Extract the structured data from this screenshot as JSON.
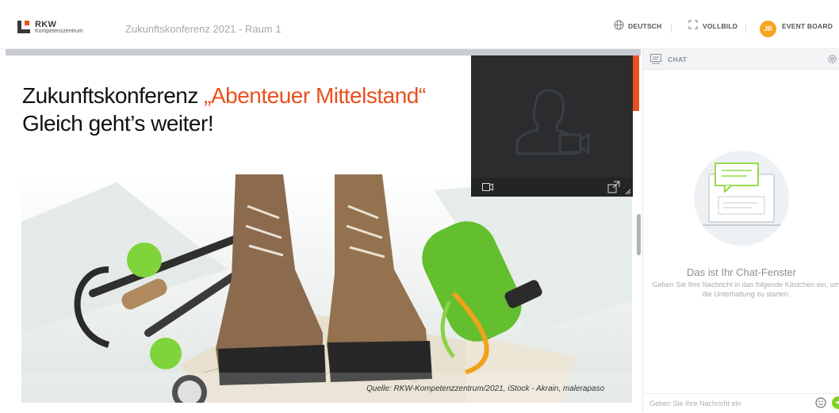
{
  "header": {
    "logo_name": "RKW",
    "logo_sub": "Kompetenzzentrum",
    "room_title": "Zukunftskonferenz 2021 - Raum 1",
    "language_label": "DEUTSCH",
    "fullscreen_label": "VOLLBILD",
    "avatar_initials": "JR",
    "event_board_label": "EVENT BOARD"
  },
  "slide": {
    "title_prefix": "Zukunftskonferenz ",
    "title_accent": "„Abenteuer Mittelstand“",
    "subtitle": "Gleich geht’s weiter!",
    "caption": "Quelle: RKW-Kompetenzzentrum/2021, iStock - Akrain, malerapaso"
  },
  "chat": {
    "header_label": "CHAT",
    "empty_title": "Das ist Ihr Chat-Fenster",
    "empty_text": "Geben Sie Ihre Nachricht in das folgende Kästchen ein, um die Unterhaltung zu starten.",
    "input_placeholder": "Geben Sie Ihre Nachricht ein"
  },
  "colors": {
    "accent": "#e8501f",
    "avatar": "#f5a623",
    "send": "#7ed321",
    "chat_illustration": "#7ed321"
  },
  "icons": {
    "language": "globe-icon",
    "fullscreen": "expand-icon",
    "chat": "chat-icon",
    "settings": "gear-icon",
    "camera": "camera-icon",
    "popout": "popout-icon",
    "emoji": "emoji-icon",
    "send": "send-icon",
    "placeholder_user": "user-video-placeholder-icon"
  }
}
